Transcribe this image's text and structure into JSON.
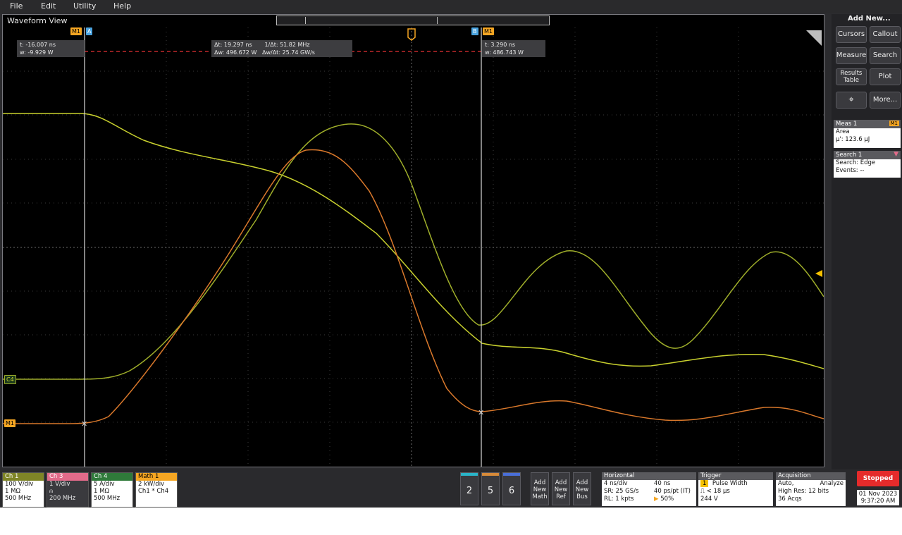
{
  "menu": {
    "file": "File",
    "edit": "Edit",
    "utility": "Utility",
    "help": "Help"
  },
  "waveform_view": {
    "title": "Waveform View",
    "cursor_a_readout": {
      "t": "t: -16.007 ns",
      "w": "w: -9.929 W"
    },
    "delta_readout": {
      "dt": "Δt: 19.297 ns",
      "inv_dt": "1/Δt: 51.82 MHz",
      "dw": "Δw: 496.672 W",
      "dw_dt": "Δw/Δt: 25.74 GW/s"
    },
    "cursor_b_readout": {
      "t": "t: 3.290 ns",
      "w": "w: 486.743 W"
    },
    "cursor_a_label": "A",
    "cursor_b_label": "B",
    "m1_label": "M1",
    "c4_label": "C4",
    "trigger_label": "T"
  },
  "right_panel": {
    "add_new": "Add New...",
    "buttons": {
      "cursors": "Cursors",
      "callout": "Callout",
      "measure": "Measure",
      "search": "Search",
      "results_table": "Results Table",
      "plot": "Plot",
      "more": "More..."
    },
    "meas1": {
      "title": "Meas 1",
      "tag": "M1",
      "name": "Area",
      "value": "μ': 123.6 μJ"
    },
    "search1": {
      "title": "Search 1",
      "type": "Search: Edge",
      "events": "Events: --"
    }
  },
  "channels": {
    "ch1": {
      "label": "Ch 1",
      "scale": "100 V/div",
      "imp": "1 MΩ",
      "bw": "500 MHz",
      "color": "#c8c83a"
    },
    "ch3": {
      "label": "Ch 3",
      "scale": "1 V/div",
      "imp": "",
      "bw": "200 MHz",
      "color": "#e26b8a"
    },
    "ch4": {
      "label": "Ch 4",
      "scale": "5 A/div",
      "imp": "1 MΩ",
      "bw": "500 MHz",
      "color": "#2fa84f"
    },
    "math1": {
      "label": "Math 1",
      "scale": "2 kW/div",
      "expr": "Ch1 * Ch4",
      "color": "#f5a623"
    }
  },
  "num_buttons": [
    "2",
    "5",
    "6"
  ],
  "add_buttons": {
    "math": "Add New Math",
    "ref": "Add New Ref",
    "bus": "Add New Bus"
  },
  "horizontal": {
    "title": "Horizontal",
    "scale": "4 ns/div",
    "duration": "40 ns",
    "sr": "SR: 25 GS/s",
    "pt": "40 ps/pt (IT)",
    "rl": "RL: 1 kpts",
    "pos": "50%"
  },
  "trigger": {
    "title": "Trigger",
    "source": "1",
    "type": "Pulse Width",
    "cond": "< 18 μs",
    "level": "244 V"
  },
  "acquisition": {
    "title": "Acquisition",
    "mode": "Auto,",
    "action": "Analyze",
    "res": "High Res: 12 bits",
    "acqs": "36 Acqs"
  },
  "status": {
    "label": "Stopped",
    "date": "01 Nov 2023",
    "time": "9:37:20 AM"
  },
  "icon_names": [
    "pointer-icon",
    "trigger-marker-icon",
    "level-arrow-icon",
    "probe-icon"
  ]
}
